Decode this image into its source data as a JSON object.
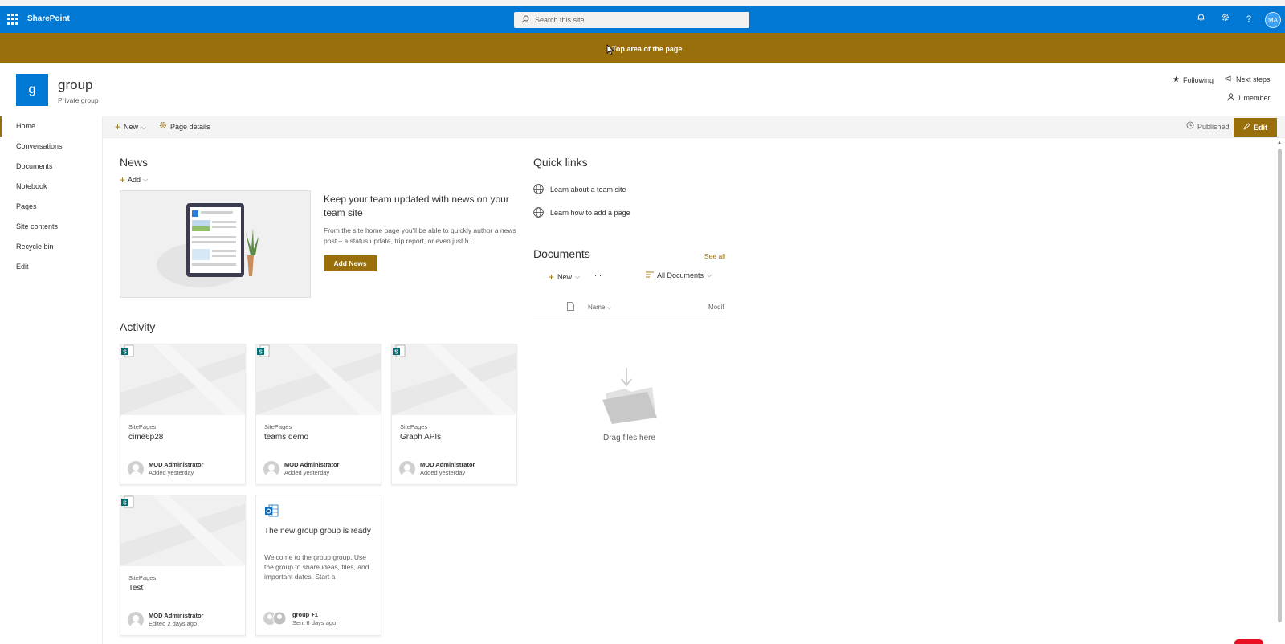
{
  "suite_bar": {
    "app_name": "SharePoint",
    "search_placeholder": "Search this site",
    "avatar_initials": "MA",
    "accent": "#0078d4"
  },
  "banner": {
    "label": "Top area of the page",
    "color": "#986f0b"
  },
  "site": {
    "logo_letter": "g",
    "title": "group",
    "subtitle": "Private group",
    "following_label": "Following",
    "next_steps_label": "Next steps",
    "members_label": "1 member"
  },
  "nav": {
    "items": [
      {
        "label": "Home",
        "selected": true
      },
      {
        "label": "Conversations"
      },
      {
        "label": "Documents"
      },
      {
        "label": "Notebook"
      },
      {
        "label": "Pages"
      },
      {
        "label": "Site contents"
      },
      {
        "label": "Recycle bin"
      },
      {
        "label": "Edit"
      }
    ]
  },
  "command_bar": {
    "new_label": "New",
    "page_details_label": "Page details",
    "published_label": "Published",
    "edit_label": "Edit"
  },
  "news": {
    "title": "News",
    "add_label": "Add",
    "headline": "Keep your team updated with news on your team site",
    "description": "From the site home page you'll be able to quickly author a news post – a status update, trip report, or even just h...",
    "add_news_label": "Add News"
  },
  "activity": {
    "title": "Activity",
    "cards": [
      {
        "type": "SitePages",
        "title": "cime6p28",
        "author": "MOD Administrator",
        "when": "Added yesterday"
      },
      {
        "type": "SitePages",
        "title": "teams demo",
        "author": "MOD Administrator",
        "when": "Added yesterday"
      },
      {
        "type": "SitePages",
        "title": "Graph APIs",
        "author": "MOD Administrator",
        "when": "Added yesterday"
      },
      {
        "type": "SitePages",
        "title": "Test",
        "author": "MOD Administrator",
        "when": "Edited 2 days ago"
      }
    ],
    "conversation_card": {
      "title": "The new group group is ready",
      "body": "Welcome to the group group. Use the group to share ideas, files, and important dates. Start a",
      "author": "group +1",
      "when": "Sent 6 days ago"
    }
  },
  "quick_links": {
    "title": "Quick links",
    "items": [
      {
        "label": "Learn about a team site",
        "icon": "globe-icon"
      },
      {
        "label": "Learn how to add a page",
        "icon": "globe-icon"
      }
    ]
  },
  "documents": {
    "title": "Documents",
    "see_all_label": "See all",
    "new_label": "New",
    "more_label": "···",
    "view_label": "All Documents",
    "col_name": "Name",
    "col_modified": "Modif",
    "empty_label": "Drag files here"
  }
}
